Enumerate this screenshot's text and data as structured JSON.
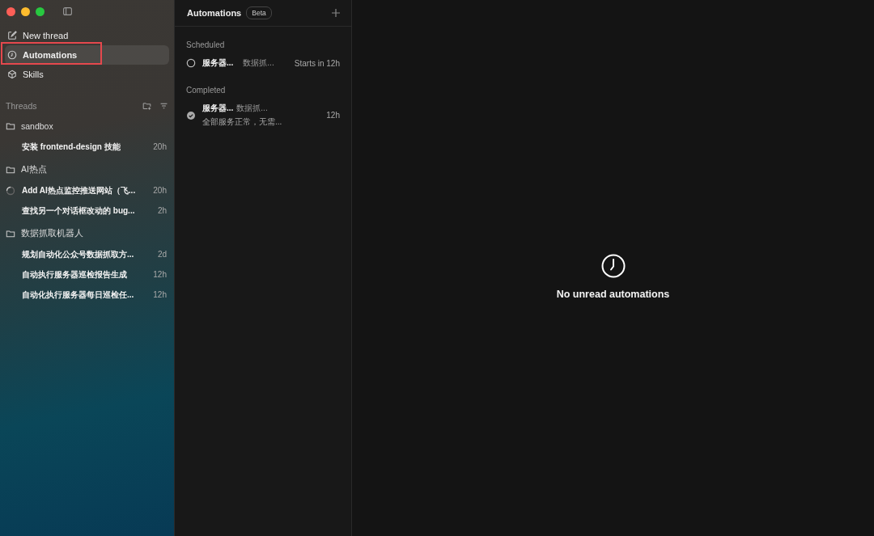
{
  "sidebar": {
    "nav": [
      {
        "kind": "new",
        "label": "New thread",
        "selected": false,
        "highlighted": false
      },
      {
        "kind": "automations",
        "label": "Automations",
        "selected": true,
        "highlighted": true
      },
      {
        "kind": "skills",
        "label": "Skills",
        "selected": false,
        "highlighted": false
      }
    ],
    "threads_title": "Threads",
    "groups": [
      {
        "name": "sandbox",
        "threads": [
          {
            "title": "安装 frontend-design 技能",
            "time": "20h",
            "running": false
          }
        ]
      },
      {
        "name": "AI热点",
        "threads": [
          {
            "title": "Add AI热点监控推送网站（飞...",
            "time": "20h",
            "running": true
          },
          {
            "title": "查找另一个对话框改动的 bug...",
            "time": "2h",
            "running": false
          }
        ]
      },
      {
        "name": "数据抓取机器人",
        "threads": [
          {
            "title": "规划自动化公众号数据抓取方...",
            "time": "2d",
            "running": false
          },
          {
            "title": "自动执行服务器巡检报告生成",
            "time": "12h",
            "running": false
          },
          {
            "title": "自动化执行服务器每日巡检任...",
            "time": "12h",
            "running": false
          }
        ]
      }
    ]
  },
  "automations": {
    "title": "Automations",
    "badge": "Beta",
    "sections": [
      {
        "heading": "Scheduled",
        "items": [
          {
            "kind": "scheduled",
            "name": "服务器...",
            "project": "数据抓...",
            "time": "Starts in 12h"
          }
        ]
      },
      {
        "heading": "Completed",
        "items": [
          {
            "kind": "completed",
            "name": "服务器...",
            "project": "数据抓...",
            "summary": "全部服务正常，无需...",
            "time": "12h"
          }
        ]
      }
    ]
  },
  "empty_state": {
    "message": "No unread automations"
  }
}
